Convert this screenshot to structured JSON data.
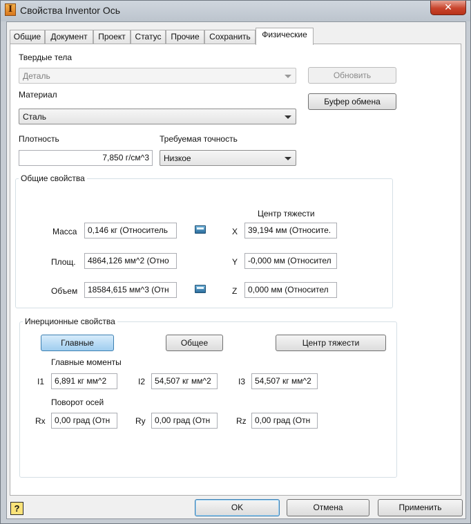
{
  "window": {
    "title": "Свойства Inventor Ось",
    "close_label": "✕"
  },
  "tabs": [
    "Общие",
    "Документ",
    "Проект",
    "Статус",
    "Прочие",
    "Сохранить",
    "Физические"
  ],
  "solids": {
    "label": "Твердые тела",
    "value": "Деталь"
  },
  "material": {
    "label": "Материал",
    "value": "Сталь"
  },
  "buttons": {
    "update": "Обновить",
    "clipboard": "Буфер обмена"
  },
  "density": {
    "label": "Плотность",
    "value": "7,850 г/см^3"
  },
  "accuracy": {
    "label": "Требуемая точность",
    "value": "Низкое"
  },
  "general": {
    "title": "Общие свойства",
    "center_title": "Центр тяжести",
    "mass_label": "Масса",
    "mass_value": "0,146 кг (Относитель",
    "area_label": "Площ.",
    "area_value": "4864,126 мм^2 (Отно",
    "volume_label": "Объем",
    "volume_value": "18584,615 мм^3 (Отн",
    "x_label": "X",
    "x_value": "39,194 мм (Относите.",
    "y_label": "Y",
    "y_value": "-0,000 мм (Относител",
    "z_label": "Z",
    "z_value": "0,000 мм (Относител"
  },
  "inertia": {
    "title": "Инерционные свойства",
    "btn_principal": "Главные",
    "btn_global": "Общее",
    "btn_center": "Центр тяжести",
    "moments_label": "Главные моменты",
    "i1_label": "I1",
    "i1_value": "6,891 кг мм^2",
    "i2_label": "I2",
    "i2_value": "54,507 кг мм^2",
    "i3_label": "I3",
    "i3_value": "54,507 кг мм^2",
    "rotation_label": "Поворот осей",
    "rx_label": "Rx",
    "rx_value": "0,00 град (Отн",
    "ry_label": "Ry",
    "ry_value": "0,00 град (Отн",
    "rz_label": "Rz",
    "rz_value": "0,00 град (Отн"
  },
  "footer": {
    "help": "?",
    "ok": "OK",
    "cancel": "Отмена",
    "apply": "Применить"
  }
}
